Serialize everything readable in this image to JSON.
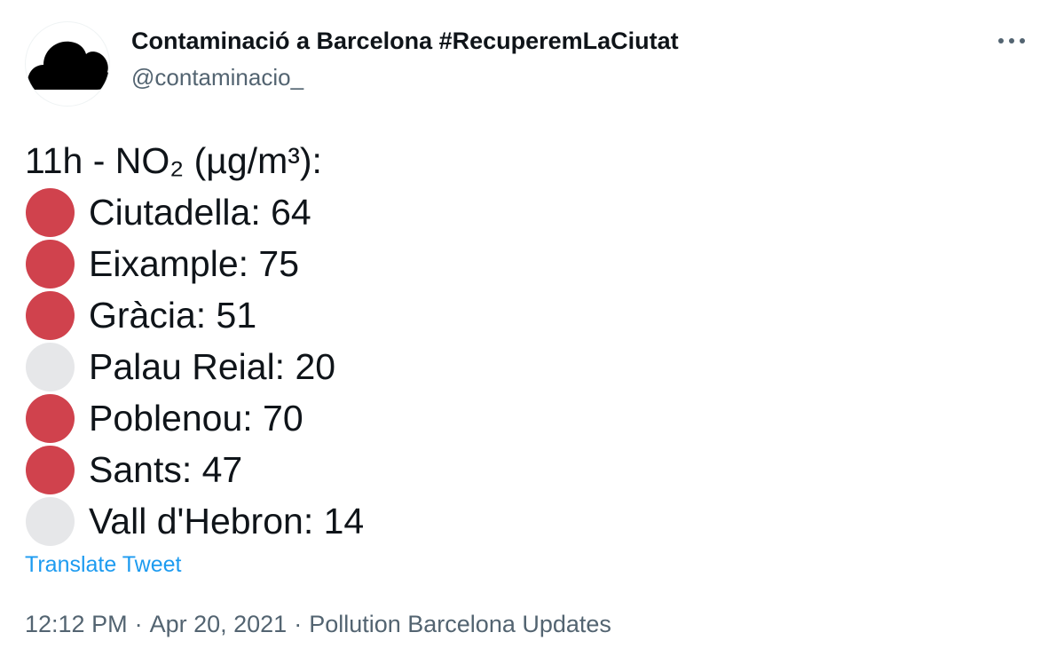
{
  "author": {
    "display_name": "Contaminació a Barcelona #RecuperemLaCiutat",
    "handle": "@contaminacio_",
    "avatar_icon": "black-cloud-icon"
  },
  "more_icon": "more-horizontal-icon",
  "tweet": {
    "heading": "11h - NO₂ (µg/m³):",
    "stations": [
      {
        "label": "Ciutadella: 64",
        "status": "red-circle"
      },
      {
        "label": "Eixample: 75",
        "status": "red-circle"
      },
      {
        "label": "Gràcia: 51",
        "status": "red-circle"
      },
      {
        "label": "Palau Reial: 20",
        "status": "white-circle"
      },
      {
        "label": "Poblenou: 70",
        "status": "red-circle"
      },
      {
        "label": "Sants: 47",
        "status": "red-circle"
      },
      {
        "label": "Vall d'Hebron: 14",
        "status": "white-circle"
      }
    ],
    "translate_label": "Translate Tweet"
  },
  "meta": {
    "time": "12:12 PM",
    "separator": "·",
    "date": "Apr 20, 2021",
    "source": "Pollution Barcelona Updates"
  },
  "colors": {
    "red_circle": "#d0424d",
    "white_circle": "#e6e7e9",
    "link": "#1d9bf0",
    "secondary_text": "#536471",
    "primary_text": "#0f1419"
  }
}
